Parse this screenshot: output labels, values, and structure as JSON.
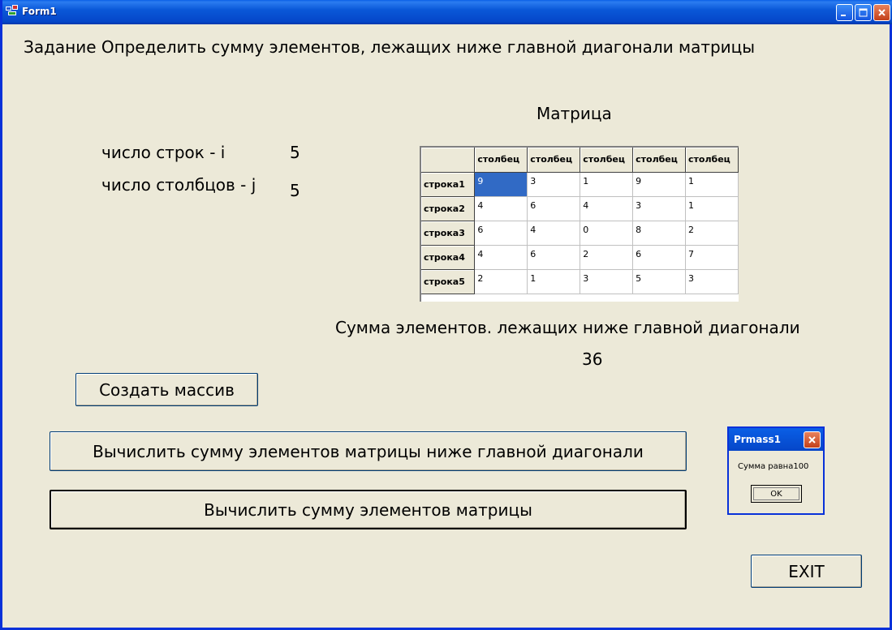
{
  "window": {
    "title": "Form1",
    "controls": [
      "minimize-icon",
      "maximize-icon",
      "close-icon"
    ]
  },
  "task": "Задание  Определить сумму элементов, лежащих ниже главной диагонали матрицы",
  "matrix_label": "Матрица",
  "rows_label": "число строк - i",
  "rows_value": "5",
  "cols_label": "число столбцов - j",
  "cols_value": "5",
  "grid": {
    "column_headers": [
      "столбец",
      "столбец",
      "столбец",
      "столбец",
      "столбец"
    ],
    "rows": [
      {
        "header": "строка1",
        "cells": [
          "9",
          "3",
          "1",
          "9",
          "1"
        ]
      },
      {
        "header": "строка2",
        "cells": [
          "4",
          "6",
          "4",
          "3",
          "1"
        ]
      },
      {
        "header": "строка3",
        "cells": [
          "6",
          "4",
          "0",
          "8",
          "2"
        ]
      },
      {
        "header": "строка4",
        "cells": [
          "4",
          "6",
          "2",
          "6",
          "7"
        ]
      },
      {
        "header": "строка5",
        "cells": [
          "2",
          "1",
          "3",
          "5",
          "3"
        ]
      }
    ],
    "selected_color": "#316ac5"
  },
  "sum_label": "Сумма элементов. лежащих ниже главной диагонали",
  "sum_value": "36",
  "buttons": {
    "create": "Создать массив",
    "sum_below": "Вычислить сумму элементов матрицы ниже главной диагонали",
    "sum_all": "Вычислить сумму элементов  матрицы",
    "exit": "EXIT"
  },
  "dialog": {
    "title": "Prmass1",
    "message": "Сумма равна100",
    "ok": "OK"
  }
}
